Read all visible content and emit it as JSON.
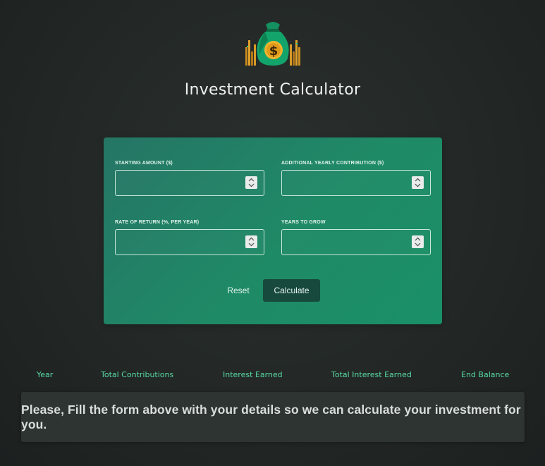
{
  "header": {
    "logo_icon": "money-bag-icon",
    "title": "Investment Calculator"
  },
  "form": {
    "fields": [
      {
        "label": "STARTING AMOUNT ($)",
        "value": "",
        "placeholder": ""
      },
      {
        "label": "ADDITIONAL YEARLY CONTRIBUTION ($)",
        "value": "",
        "placeholder": ""
      },
      {
        "label": "RATE OF RETURN (%, PER YEAR)",
        "value": "",
        "placeholder": ""
      },
      {
        "label": "YEARS TO GROW",
        "value": "",
        "placeholder": ""
      }
    ],
    "reset_label": "Reset",
    "calculate_label": "Calculate"
  },
  "table": {
    "columns": [
      "Year",
      "Total Contributions",
      "Interest Earned",
      "Total Interest Earned",
      "End Balance"
    ]
  },
  "message": "Please, Fill the form above with your details so we can calculate your investment for you.",
  "colors": {
    "background": "#232826",
    "card_gradient_start": "#257565",
    "card_gradient_end": "#1a9068",
    "accent": "#58d8a4",
    "calculate_button": "#17493d",
    "message_box": "#2e3432"
  }
}
